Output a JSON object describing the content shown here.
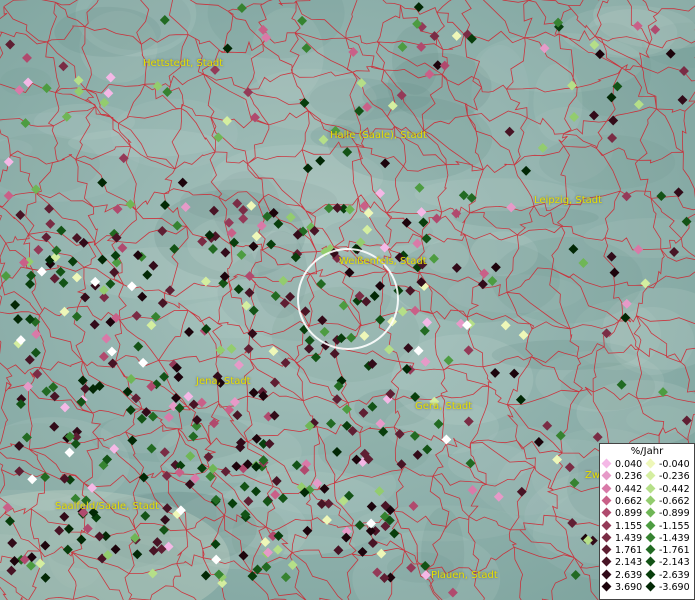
{
  "map": {
    "cities": [
      {
        "id": "hettstedt",
        "label": "Hettstedt, Stadt"
      },
      {
        "id": "halle",
        "label": "Halle (Saale), Stadt"
      },
      {
        "id": "leipzig",
        "label": "Leipzig, Stadt"
      },
      {
        "id": "weissenfels",
        "label": "Weißenfels, Stadt"
      },
      {
        "id": "jena",
        "label": "Jena, Stadt"
      },
      {
        "id": "gera",
        "label": "Gera, Stadt"
      },
      {
        "id": "saalfeld",
        "label": "Saalfeld/Saale, Stadt"
      },
      {
        "id": "plauen",
        "label": "Plauen, Stadt"
      },
      {
        "id": "zwickau",
        "label": "Zw"
      }
    ],
    "colors": {
      "border": "#d21f2a",
      "circle": "#ffffff",
      "label": "#e6e000"
    }
  },
  "legend": {
    "title": "%/Jahr",
    "positive": [
      {
        "value": "0.040",
        "color": "#f4b8e6"
      },
      {
        "value": "0.236",
        "color": "#e69ac8"
      },
      {
        "value": "0.442",
        "color": "#d97aa8"
      },
      {
        "value": "0.662",
        "color": "#c96088"
      },
      {
        "value": "0.899",
        "color": "#b04a6e"
      },
      {
        "value": "1.155",
        "color": "#943a58"
      },
      {
        "value": "1.439",
        "color": "#7a2c45"
      },
      {
        "value": "1.761",
        "color": "#5f1f33"
      },
      {
        "value": "2.143",
        "color": "#481425"
      },
      {
        "value": "2.639",
        "color": "#320b19"
      },
      {
        "value": "3.690",
        "color": "#1c040c"
      }
    ],
    "negative": [
      {
        "value": "-0.040",
        "color": "#eef7b8"
      },
      {
        "value": "-0.236",
        "color": "#d4eea0"
      },
      {
        "value": "-0.442",
        "color": "#b5df88"
      },
      {
        "value": "-0.662",
        "color": "#93cc6e"
      },
      {
        "value": "-0.899",
        "color": "#6fb656"
      },
      {
        "value": "-1.155",
        "color": "#4d9c41"
      },
      {
        "value": "-1.439",
        "color": "#368330"
      },
      {
        "value": "-1.761",
        "color": "#226a22"
      },
      {
        "value": "-2.143",
        "color": "#135316"
      },
      {
        "value": "-2.639",
        "color": "#083e0c"
      },
      {
        "value": "-3.690",
        "color": "#022805"
      }
    ]
  }
}
